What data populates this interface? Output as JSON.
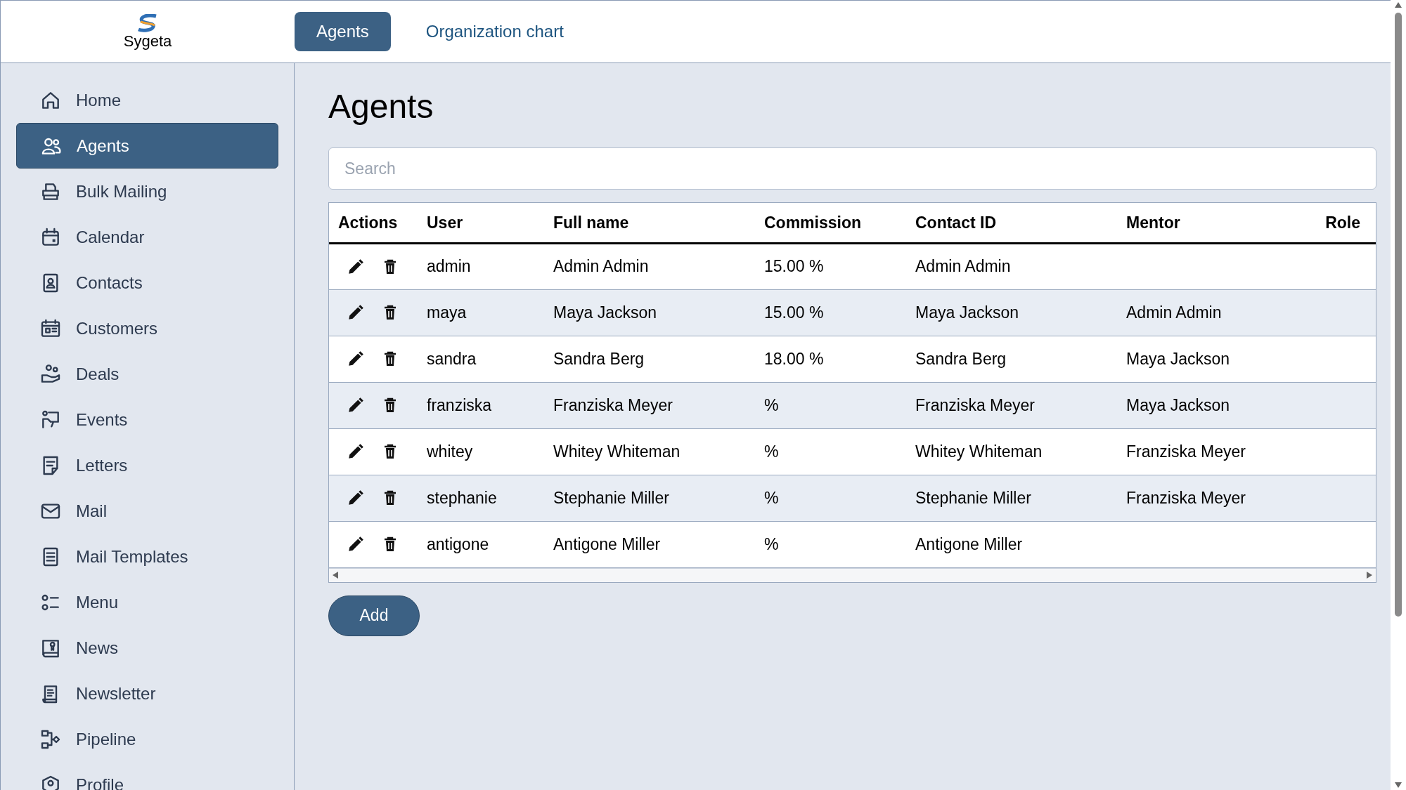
{
  "header": {
    "logo_text": "Sygeta",
    "tabs": [
      {
        "label": "Agents",
        "selected": true
      },
      {
        "label": "Organization chart",
        "selected": false
      }
    ]
  },
  "sidebar": {
    "items": [
      {
        "label": "Home",
        "selected": false
      },
      {
        "label": "Agents",
        "selected": true
      },
      {
        "label": "Bulk Mailing",
        "selected": false
      },
      {
        "label": "Calendar",
        "selected": false
      },
      {
        "label": "Contacts",
        "selected": false
      },
      {
        "label": "Customers",
        "selected": false
      },
      {
        "label": "Deals",
        "selected": false
      },
      {
        "label": "Events",
        "selected": false
      },
      {
        "label": "Letters",
        "selected": false
      },
      {
        "label": "Mail",
        "selected": false
      },
      {
        "label": "Mail Templates",
        "selected": false
      },
      {
        "label": "Menu",
        "selected": false
      },
      {
        "label": "News",
        "selected": false
      },
      {
        "label": "Newsletter",
        "selected": false
      },
      {
        "label": "Pipeline",
        "selected": false
      },
      {
        "label": "Profile",
        "selected": false
      }
    ]
  },
  "page": {
    "title": "Agents",
    "search": {
      "placeholder": "Search"
    },
    "table": {
      "columns": [
        "Actions",
        "User",
        "Full name",
        "Commission",
        "Contact ID",
        "Mentor",
        "Role"
      ],
      "rows": [
        {
          "user": "admin",
          "full_name": "Admin Admin",
          "commission": "15.00 %",
          "contact_id": "Admin Admin",
          "mentor": ""
        },
        {
          "user": "maya",
          "full_name": "Maya Jackson",
          "commission": "15.00 %",
          "contact_id": "Maya Jackson",
          "mentor": "Admin Admin"
        },
        {
          "user": "sandra",
          "full_name": "Sandra Berg",
          "commission": "18.00 %",
          "contact_id": "Sandra Berg",
          "mentor": "Maya Jackson"
        },
        {
          "user": "franziska",
          "full_name": "Franziska Meyer",
          "commission": "%",
          "contact_id": "Franziska Meyer",
          "mentor": "Maya Jackson"
        },
        {
          "user": "whitey",
          "full_name": "Whitey Whiteman",
          "commission": "%",
          "contact_id": "Whitey Whiteman",
          "mentor": "Franziska Meyer"
        },
        {
          "user": "stephanie",
          "full_name": "Stephanie Miller",
          "commission": "%",
          "contact_id": "Stephanie Miller",
          "mentor": "Franziska Meyer"
        },
        {
          "user": "antigone",
          "full_name": "Antigone Miller",
          "commission": "%",
          "contact_id": "Antigone Miller",
          "mentor": ""
        }
      ]
    },
    "add_button": "Add"
  }
}
